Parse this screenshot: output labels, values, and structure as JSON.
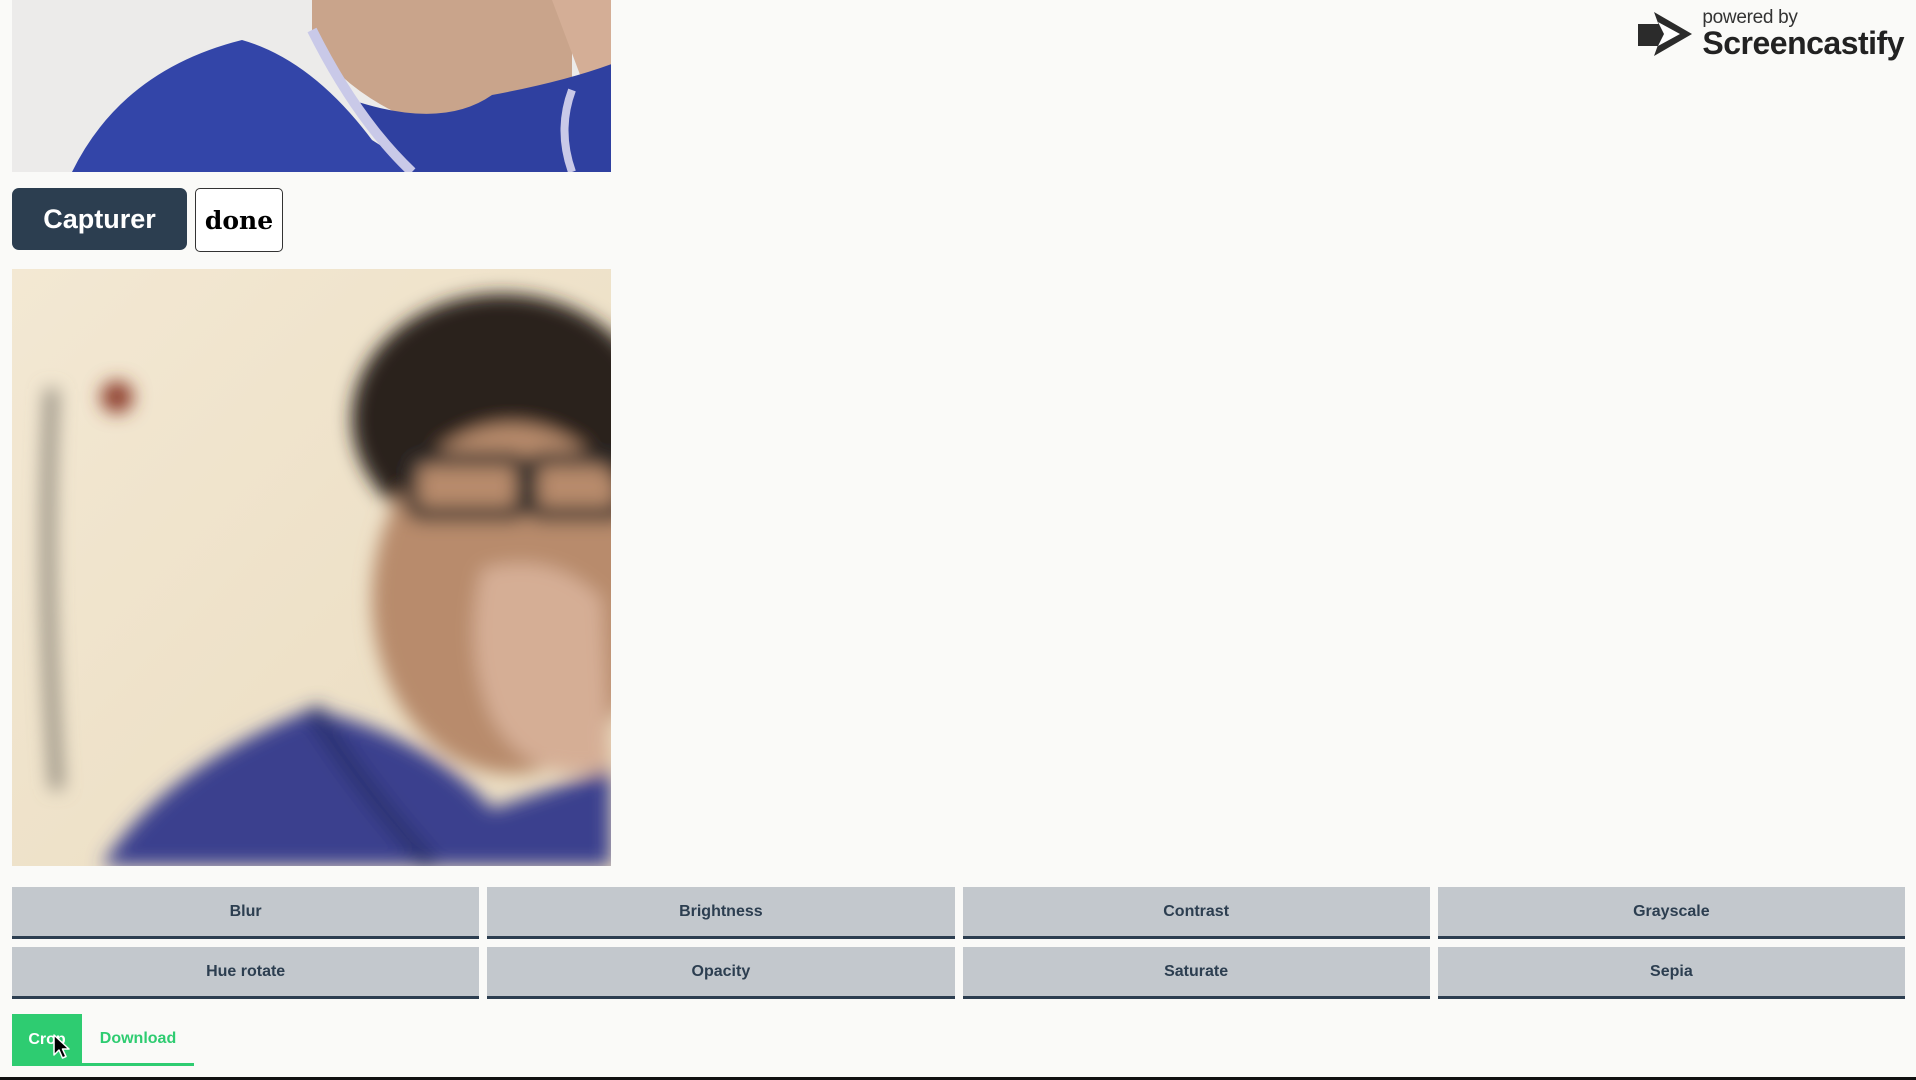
{
  "capture": {
    "capture_label": "Capturer",
    "done_label": "done"
  },
  "filters": [
    {
      "label": "Blur"
    },
    {
      "label": "Brightness"
    },
    {
      "label": "Contrast"
    },
    {
      "label": "Grayscale"
    },
    {
      "label": "Hue rotate"
    },
    {
      "label": "Opacity"
    },
    {
      "label": "Saturate"
    },
    {
      "label": "Sepia"
    }
  ],
  "actions": {
    "crop_label": "Crop",
    "download_label": "Download"
  },
  "watermark": {
    "powered_by": "powered by",
    "brand": "Screencastify"
  },
  "colors": {
    "primary_dark": "#2c3e50",
    "filter_bg": "#c3c8cd",
    "accent_green": "#2ecc71",
    "page_bg": "#fafaf8"
  }
}
